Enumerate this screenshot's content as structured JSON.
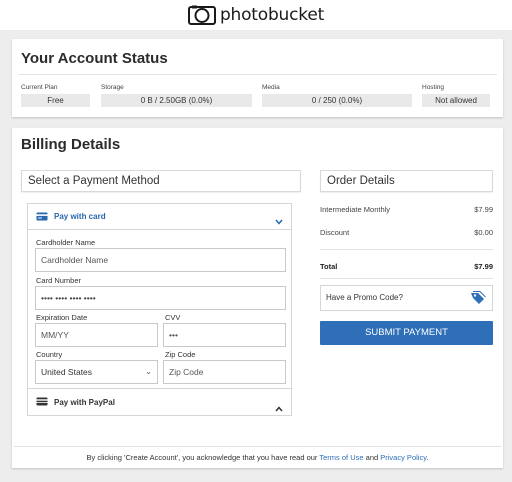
{
  "header": {
    "logo_text": "photobucket"
  },
  "account_status": {
    "title": "Your Account Status",
    "stats": [
      {
        "label": "Current Plan",
        "value": "Free"
      },
      {
        "label": "Storage",
        "value": "0 B / 2.50GB (0.0%)"
      },
      {
        "label": "Media",
        "value": "0 / 250 (0.0%)"
      },
      {
        "label": "Hosting",
        "value": "Not allowed"
      }
    ]
  },
  "billing": {
    "title": "Billing Details",
    "payment_method_title": "Select a Payment Method",
    "pay_with_card_label": "Pay with card",
    "cardholder_label": "Cardholder Name",
    "cardholder_placeholder": "Cardholder Name",
    "card_number_label": "Card Number",
    "card_number_placeholder": "•••• •••• •••• ••••",
    "expiration_label": "Expiration Date",
    "expiration_placeholder": "MM/YY",
    "cvv_label": "CVV",
    "cvv_placeholder": "•••",
    "country_label": "Country",
    "country_value": "United States",
    "zip_label": "Zip Code",
    "zip_placeholder": "Zip Code",
    "pay_with_paypal_label": "Pay with PayPal"
  },
  "order": {
    "title": "Order Details",
    "items": [
      {
        "label": "Intermediate Monthly",
        "amount": "$7.99"
      },
      {
        "label": "Discount",
        "amount": "$0.00"
      }
    ],
    "total_label": "Total",
    "total_amount": "$7.99",
    "promo_label": "Have a Promo Code?",
    "submit_label": "SUBMIT PAYMENT"
  },
  "footer": {
    "text_before": "By clicking 'Create Account', you acknowledge that you have read our ",
    "terms_link": "Terms of Use",
    "text_and": " and ",
    "privacy_link": "Privacy Policy",
    "text_after": "."
  },
  "colors": {
    "accent": "#2e6fb8",
    "link": "#2667ad"
  }
}
